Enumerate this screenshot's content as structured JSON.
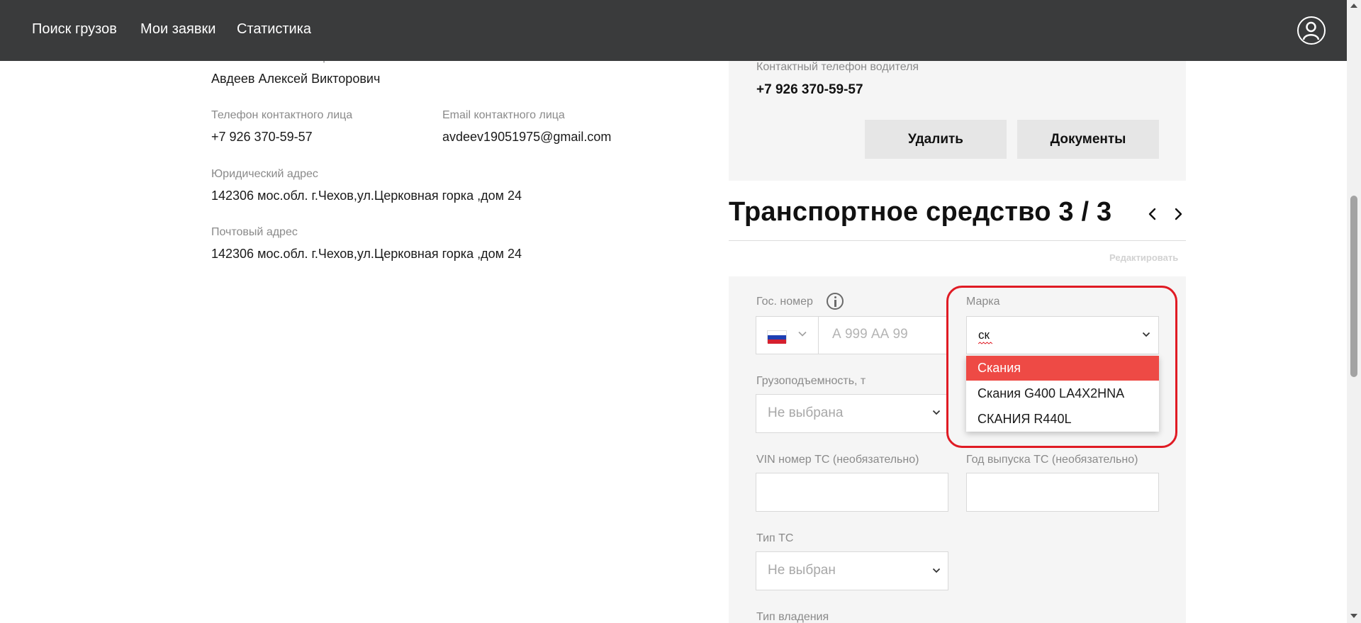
{
  "nav": {
    "links": [
      "Поиск грузов",
      "Мои заявки",
      "Статистика"
    ],
    "profile_icon": "user-circle-icon"
  },
  "contact": {
    "cut_label": "ФИО контактного лица",
    "name": "Авдеев Алексей Викторович",
    "phone_label": "Телефон контактного лица",
    "phone": "+7 926 370-59-57",
    "email_label": "Email контактного лица",
    "email": "avdeev19051975@gmail.com",
    "legal_address_label": "Юридический адрес",
    "legal_address": "142306 мос.обл. г.Чехов,ул.Церковная горка ,дом 24",
    "postal_address_label": "Почтовый адрес",
    "postal_address": "142306 мос.обл. г.Чехов,ул.Церковная горка ,дом 24"
  },
  "driver": {
    "phone_label": "Контактный телефон водителя",
    "phone": "+7 926 370-59-57",
    "delete_button": "Удалить",
    "documents_button": "Документы"
  },
  "vehicle": {
    "title": "Транспортное средство 3 / 3",
    "prev_icon": "chevron-left-icon",
    "next_icon": "chevron-right-icon",
    "edit_link": "Редактировать",
    "form": {
      "plate_label": "Гос. номер",
      "plate_info_icon": "info-icon",
      "plate_flag": "russia-flag-icon",
      "plate_placeholder": "А 999 АА 99",
      "brand_label": "Марка",
      "brand_value": "ск",
      "brand_options": [
        "Скания",
        "Скания G400 LA4X2HNA",
        "СКАНИЯ R440L"
      ],
      "brand_highlighted_option": "Скания",
      "capacity_label": "Грузоподъемность, т",
      "capacity_value": "Не выбрана",
      "vin_label": "VIN номер ТС (необязательно)",
      "vin_value": "",
      "year_label": "Год выпуска ТС (необязательно)",
      "year_value": "",
      "type_label": "Тип ТС",
      "type_value": "Не выбран",
      "ownership_label": "Тип владения"
    }
  },
  "colors": {
    "topbar": "#3a3b3c",
    "accent_red": "#ee4a45",
    "highlight_red": "#e01b24",
    "panel_grey": "#f5f5f5"
  }
}
